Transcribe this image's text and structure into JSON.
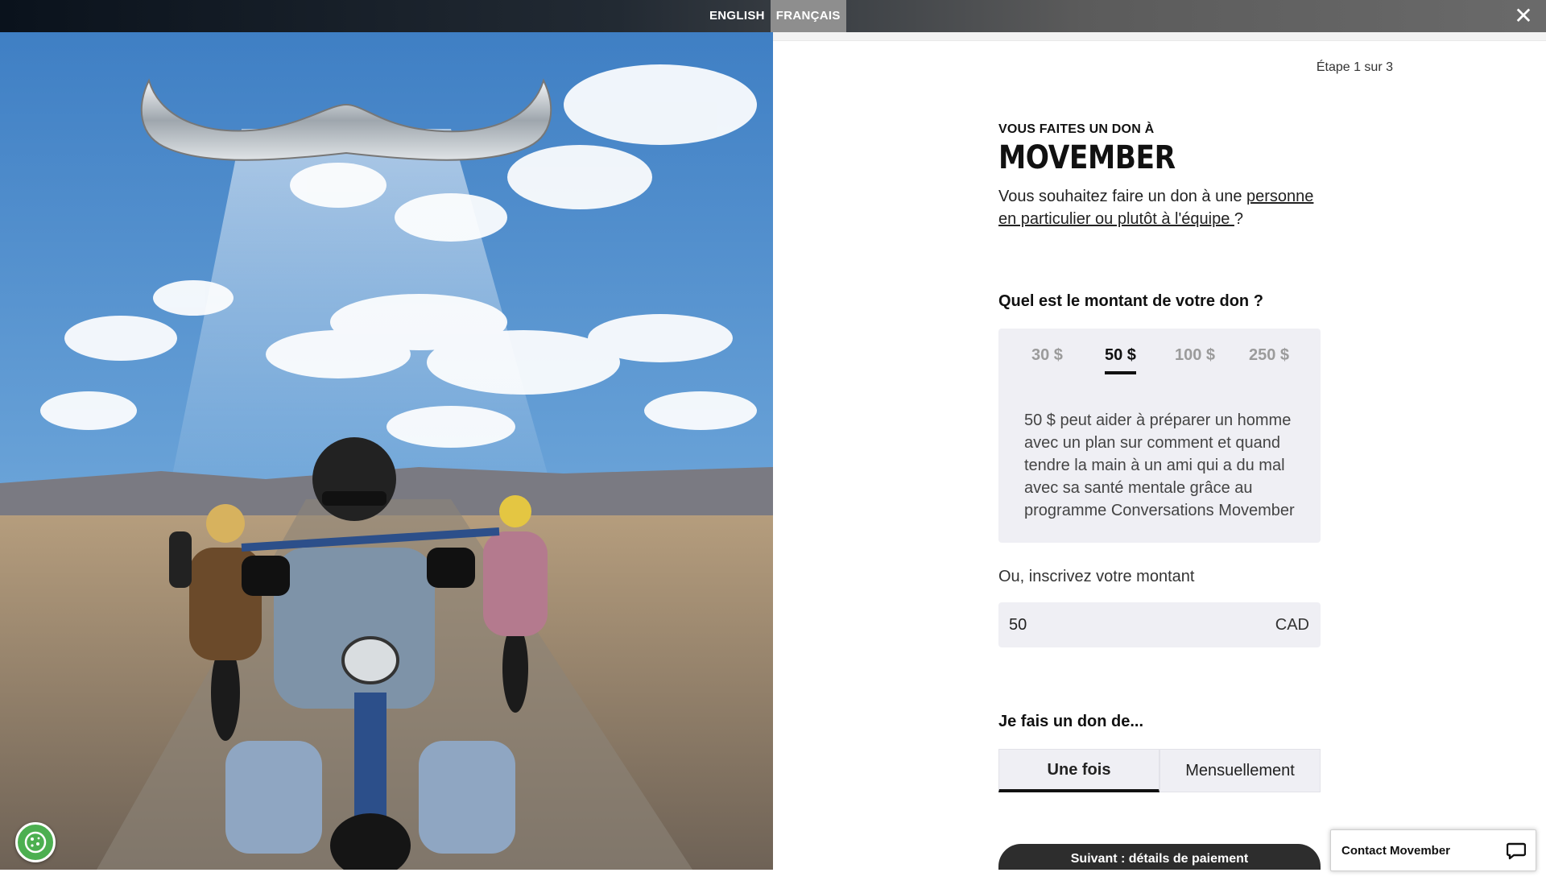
{
  "language": {
    "options": [
      "ENGLISH",
      "FRANÇAIS"
    ],
    "selected": "FRANÇAIS"
  },
  "step_text": "Étape 1 sur 3",
  "donation": {
    "eyebrow": "VOUS FAITES UN DON À",
    "recipient": "MOVEMBER",
    "intro_prefix": "Vous souhaitez faire un don à une ",
    "intro_link": "personne en particulier ou plutôt à l'équipe ",
    "intro_suffix": "?",
    "amount_question": "Quel est le montant de votre don ?",
    "amounts": [
      "30 $",
      "50 $",
      "100 $",
      "250 $"
    ],
    "selected_amount": "50 $",
    "amount_description": "50 $ peut aider à préparer un homme avec un plan sur comment et quand tendre la main à un ami qui a du mal avec sa santé mentale grâce au programme Conversations Movember",
    "custom_label": "Ou, inscrivez votre montant",
    "custom_value": "50",
    "currency": "CAD",
    "frequency_question": "Je fais un don de...",
    "frequency_options": [
      "Une fois",
      "Mensuellement"
    ],
    "frequency_selected": "Une fois",
    "next_label": "Suivant : détails de paiement"
  },
  "contact_widget": {
    "label": "Contact Movember",
    "icon": "chat-bubble-icon"
  },
  "icons": {
    "close": "close-icon",
    "cookie": "cookie-icon"
  },
  "colors": {
    "cookie_button": "#4caf50",
    "primary_button": "#2d2d2d",
    "selection_box": "#efeff4"
  }
}
